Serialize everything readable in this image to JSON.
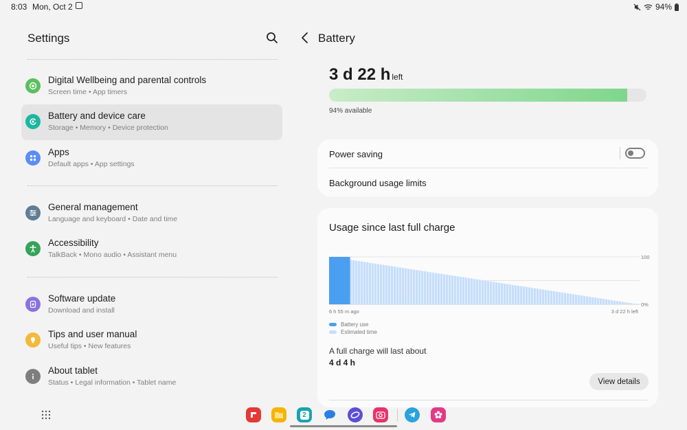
{
  "status_bar": {
    "time": "8:03",
    "date": "Mon, Oct 2",
    "battery_pct": "94%"
  },
  "left_pane": {
    "title": "Settings",
    "groups": [
      [
        {
          "label": "Digital Wellbeing and parental controls",
          "sub": "Screen time  •  App timers",
          "icon": "digital-wellbeing-icon",
          "color": "#5bbf5f"
        },
        {
          "label": "Battery and device care",
          "sub": "Storage  •  Memory  •  Device protection",
          "icon": "device-care-icon",
          "color": "#1cb6a1"
        },
        {
          "label": "Apps",
          "sub": "Default apps  •  App settings",
          "icon": "apps-icon",
          "color": "#5b8df5"
        }
      ],
      [
        {
          "label": "General management",
          "sub": "Language and keyboard  •  Date and time",
          "icon": "sliders-icon",
          "color": "#607d95"
        },
        {
          "label": "Accessibility",
          "sub": "TalkBack  •  Mono audio  •  Assistant menu",
          "icon": "accessibility-icon",
          "color": "#36a25a"
        }
      ],
      [
        {
          "label": "Software update",
          "sub": "Download and install",
          "icon": "software-update-icon",
          "color": "#8a72e0"
        },
        {
          "label": "Tips and user manual",
          "sub": "Useful tips  •  New features",
          "icon": "lightbulb-icon",
          "color": "#f4b93a"
        },
        {
          "label": "About tablet",
          "sub": "Status  •  Legal information  •  Tablet name",
          "icon": "info-icon",
          "color": "#7e7e7e"
        }
      ]
    ]
  },
  "right_pane": {
    "title": "Battery",
    "time_left": "3 d 22 h",
    "time_left_suffix": "left",
    "battery_level": 0.94,
    "available_text": "94% available",
    "power_saving_label": "Power saving",
    "power_saving_on": false,
    "background_limits_label": "Background usage limits",
    "usage": {
      "title": "Usage since last full charge",
      "full_charge_label": "A full charge will last about",
      "full_charge_value": "4 d 4 h",
      "view_details_label": "View details"
    }
  },
  "chart_data": {
    "type": "area",
    "y_tick_top": "100",
    "y_tick_bottom": "0%",
    "ylim": [
      0,
      100
    ],
    "x_start_label": "6 h 55 m ago",
    "x_end_label": "3 d 22 h left",
    "series": [
      {
        "name": "Battery use",
        "color": "#4a9ff0",
        "points": [
          [
            0,
            100
          ],
          [
            0.068,
            100
          ],
          [
            0.068,
            94
          ]
        ]
      },
      {
        "name": "Estimated time",
        "color": "#c6defa",
        "points": [
          [
            0.068,
            94
          ],
          [
            1.0,
            0
          ]
        ]
      }
    ]
  },
  "dock": {
    "apps": [
      {
        "name": "flipboard-app-icon",
        "color": "#e53935"
      },
      {
        "name": "my-files-app-icon",
        "color": "#f5b400"
      },
      {
        "name": "calendar-app-icon",
        "color": "#16a4b0",
        "text": "2"
      },
      {
        "name": "messages-app-icon",
        "color": "#2a7ee8"
      },
      {
        "name": "internet-app-icon",
        "color": "#5b4ed8"
      },
      {
        "name": "camera-app-icon",
        "color": "#e8336a"
      },
      {
        "name": "telegram-app-icon",
        "color": "#2aa3dd"
      },
      {
        "name": "blossom-app-icon",
        "color": "#e23a86"
      }
    ]
  }
}
